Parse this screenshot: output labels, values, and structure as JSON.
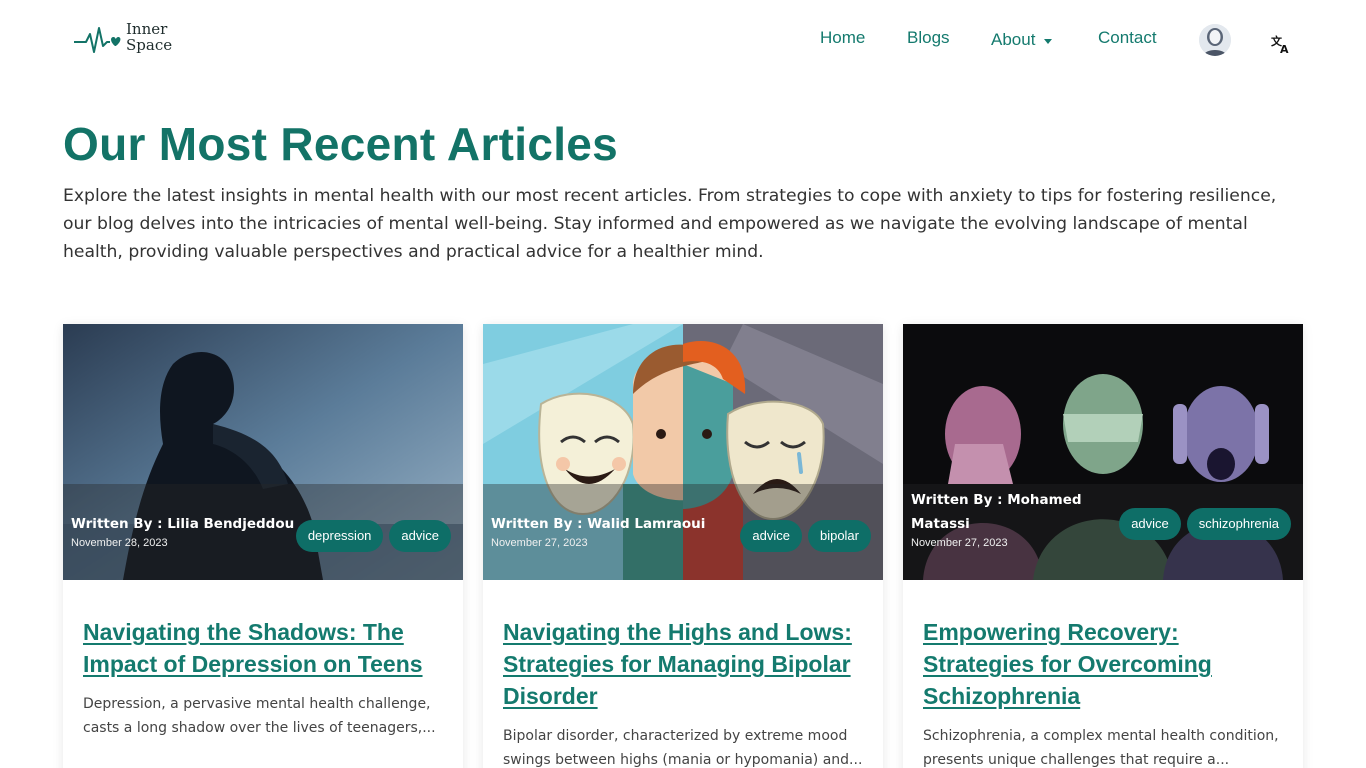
{
  "header": {
    "logo_line1": "Inner",
    "logo_line2": "Space",
    "nav": {
      "home": "Home",
      "blogs": "Blogs",
      "about": "About",
      "contact": "Contact"
    },
    "icons": [
      "heartbeat-logo-icon",
      "user-avatar-icon",
      "translate-icon",
      "chevron-down-icon"
    ]
  },
  "hero": {
    "title": "Our Most Recent Articles",
    "intro": "Explore the latest insights in mental health with our most recent articles. From strategies to cope with anxiety to tips for fostering resilience, our blog delves into the intricacies of mental well-being. Stay informed and empowered as we navigate the evolving landscape of mental health, providing valuable perspectives and practical advice for a healthier mind."
  },
  "articles": [
    {
      "author_prefix": "Written By : ",
      "author": "Lilia Bendjeddou",
      "date": "November 28, 2023",
      "tags": [
        "depression",
        "advice"
      ],
      "title": "Navigating the Shadows: The Impact of Depression on Teens",
      "excerpt": "Depression, a pervasive mental health challenge, casts a long shadow over the lives of teenagers,..."
    },
    {
      "author_prefix": "Written By : ",
      "author": "Walid Lamraoui",
      "date": "November 27, 2023",
      "tags": [
        "advice",
        "bipolar"
      ],
      "title": "Navigating the Highs and Lows: Strategies for Managing Bipolar Disorder",
      "excerpt": "Bipolar disorder, characterized by extreme mood swings between highs (mania or hypomania) and..."
    },
    {
      "author_prefix": "Written By : ",
      "author": "Mohamed Matassi",
      "date": "November 27, 2023",
      "tags": [
        "advice",
        "schizophrenia"
      ],
      "title": "Empowering Recovery: Strategies for Overcoming Schizophrenia",
      "excerpt": "Schizophrenia, a complex mental health condition, presents unique challenges that require a..."
    }
  ],
  "colors": {
    "brand": "#137367",
    "tag_bg": "#0e6e67",
    "link": "#147a6e"
  }
}
